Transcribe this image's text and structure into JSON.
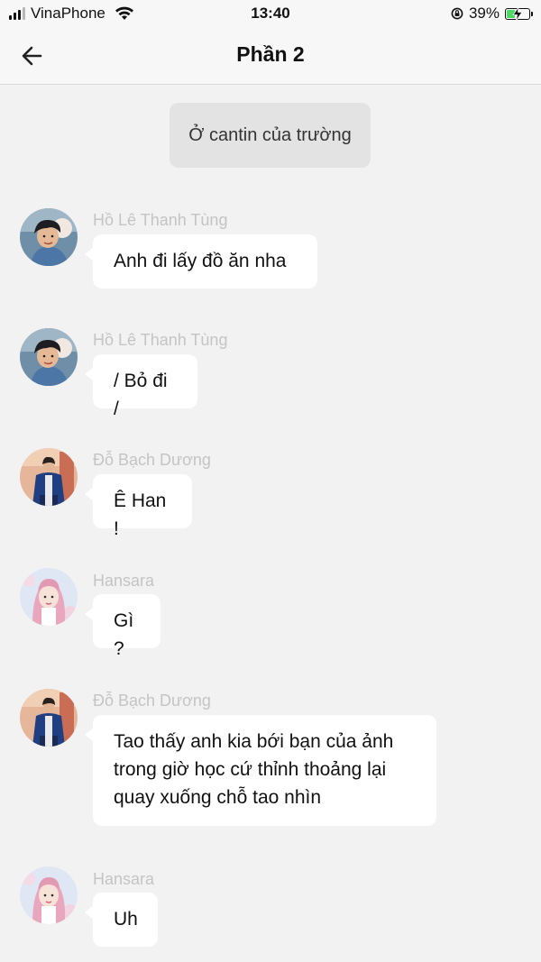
{
  "status_bar": {
    "carrier": "VinaPhone",
    "time": "13:40",
    "battery_percent": "39%",
    "battery_level": 0.39,
    "charging": true
  },
  "header": {
    "title": "Phần 2",
    "back_icon": "arrow-left-icon"
  },
  "scene": {
    "text": "Ở cantin của trường"
  },
  "messages": [
    {
      "sender": "Hồ Lê Thanh Tùng",
      "text": "Anh đi lấy đồ ăn nha",
      "avatar": "avatar-boy-headphones"
    },
    {
      "sender": "Hồ Lê Thanh Tùng",
      "text": "/ Bỏ đi /",
      "avatar": "avatar-boy-headphones"
    },
    {
      "sender": "Đỗ Bạch Dương",
      "text": "Ê Han !",
      "avatar": "avatar-boy-blue-jacket"
    },
    {
      "sender": "Hansara",
      "text": "Gì ?",
      "avatar": "avatar-girl-pink"
    },
    {
      "sender": "Đỗ Bạch Dương",
      "text": "Tao thấy anh kia bới bạn của ảnh trong giờ học cứ thỉnh thoảng lại quay xuống chỗ tao nhìn",
      "avatar": "avatar-boy-blue-jacket"
    },
    {
      "sender": "Hansara",
      "text": "Uh",
      "avatar": "avatar-girl-pink"
    }
  ]
}
